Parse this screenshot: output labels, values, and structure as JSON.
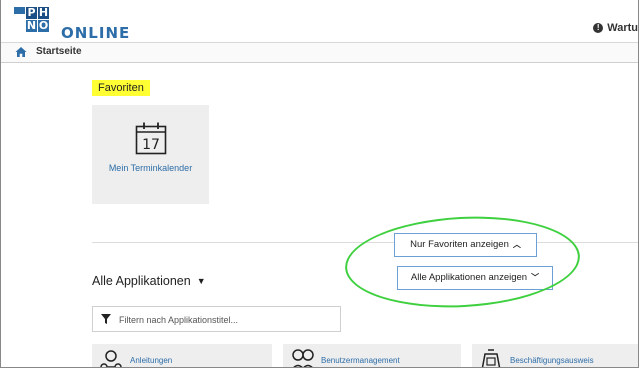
{
  "header": {
    "logo_letters": [
      "P",
      "H",
      "N",
      "O"
    ],
    "logo_text": "ONLINE",
    "notice_text": "Wartu"
  },
  "breadcrumb": {
    "home_icon": "home-icon",
    "label": "Startseite"
  },
  "favorites": {
    "title": "Favoriten",
    "tiles": [
      {
        "label": "Mein Terminkalender",
        "icon": "calendar-icon",
        "day": "17"
      }
    ]
  },
  "toggles": {
    "only_favorites": "Nur Favoriten anzeigen",
    "all_apps": "Alle Applikationen anzeigen"
  },
  "applications": {
    "title": "Alle Applikationen",
    "filter_placeholder": "Filtern nach Applikationstitel...",
    "tiles": [
      {
        "label": "Anleitungen",
        "icon": "instructions-icon"
      },
      {
        "label": "Benutzermanagement",
        "icon": "user-management-icon"
      },
      {
        "label": "Beschäftigungsausweis",
        "icon": "id-card-icon"
      }
    ]
  },
  "colors": {
    "brand": "#2d6da8",
    "highlight": "#ffff33",
    "annotation": "#3fd03f",
    "button_border": "#6aa0d6"
  }
}
